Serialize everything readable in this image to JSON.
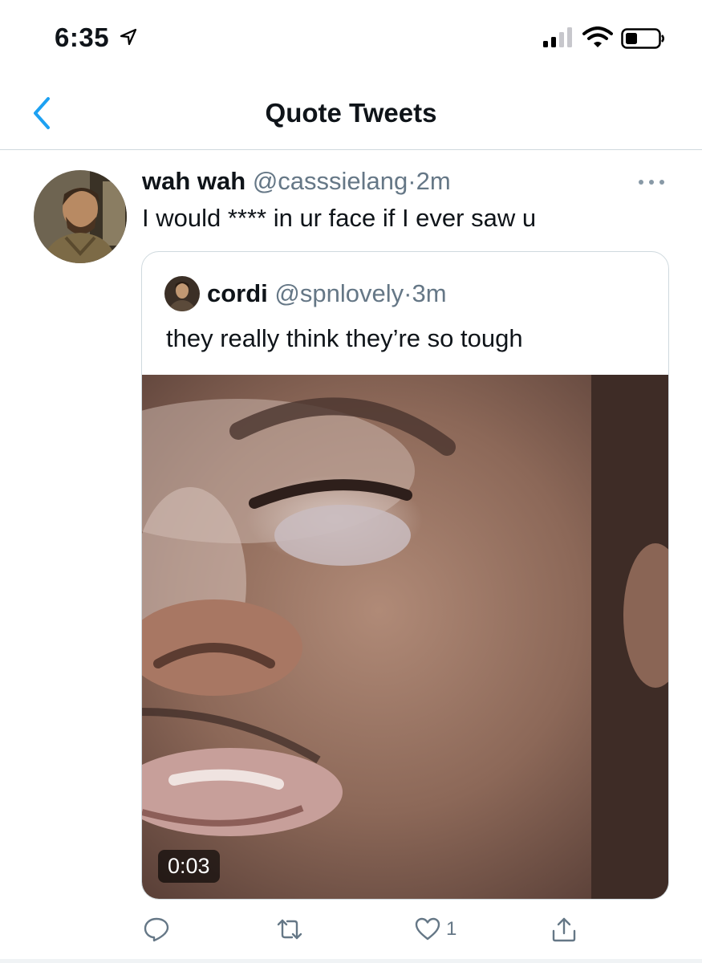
{
  "status_bar": {
    "time": "6:35",
    "icons": [
      "location-arrow-icon",
      "signal-bars-icon",
      "wifi-icon",
      "battery-icon"
    ]
  },
  "header": {
    "title": "Quote Tweets",
    "back_icon": "chevron-left-icon"
  },
  "tweet": {
    "display_name": "wah wah",
    "handle": "@casssielang",
    "separator": "·",
    "time": "2m",
    "text": "I would **** in ur face if I ever saw u",
    "more_icon": "more-dots-icon",
    "quoted": {
      "display_name": "cordi",
      "handle": "@spnlovely",
      "separator": "·",
      "time": "3m",
      "text": "they really think they’re so tough",
      "video_duration": "0:03"
    },
    "actions": {
      "reply_icon": "reply-icon",
      "retweet_icon": "retweet-icon",
      "like_icon": "heart-icon",
      "like_count": "1",
      "share_icon": "share-icon"
    }
  },
  "colors": {
    "accent": "#1da1f2",
    "muted": "#657786",
    "border": "#cfd9de"
  }
}
